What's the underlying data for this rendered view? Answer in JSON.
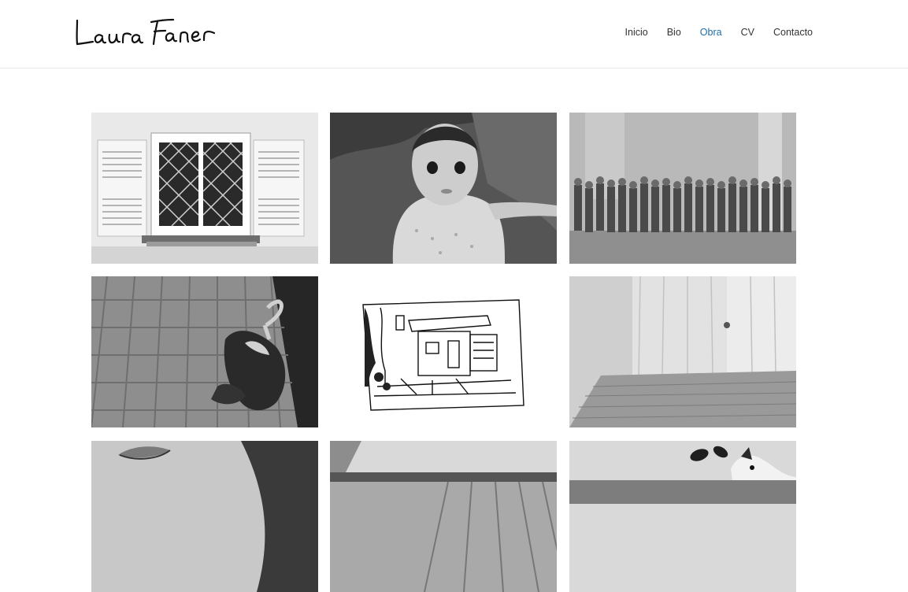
{
  "site": {
    "logo_text": "Laura Faner"
  },
  "nav": {
    "items": [
      {
        "label": "Inicio",
        "active": false
      },
      {
        "label": "Bio",
        "active": false
      },
      {
        "label": "Obra",
        "active": true
      },
      {
        "label": "CV",
        "active": false
      },
      {
        "label": "Contacto",
        "active": false
      }
    ]
  },
  "colors": {
    "nav_text": "#333333",
    "nav_active": "#1e6fa8",
    "header_border": "#e6e6e6"
  },
  "gallery": {
    "tiles": [
      {
        "subject": "window-with-shutters-photo"
      },
      {
        "subject": "baby-portrait-photo"
      },
      {
        "subject": "group-of-people-photo"
      },
      {
        "subject": "dog-on-sidewalk-photo"
      },
      {
        "subject": "house-ink-drawing"
      },
      {
        "subject": "empty-curtained-room-photo"
      },
      {
        "subject": "woman-lips-closeup-photo"
      },
      {
        "subject": "wooden-deck-photo"
      },
      {
        "subject": "dog-on-sofa-photo"
      }
    ]
  }
}
